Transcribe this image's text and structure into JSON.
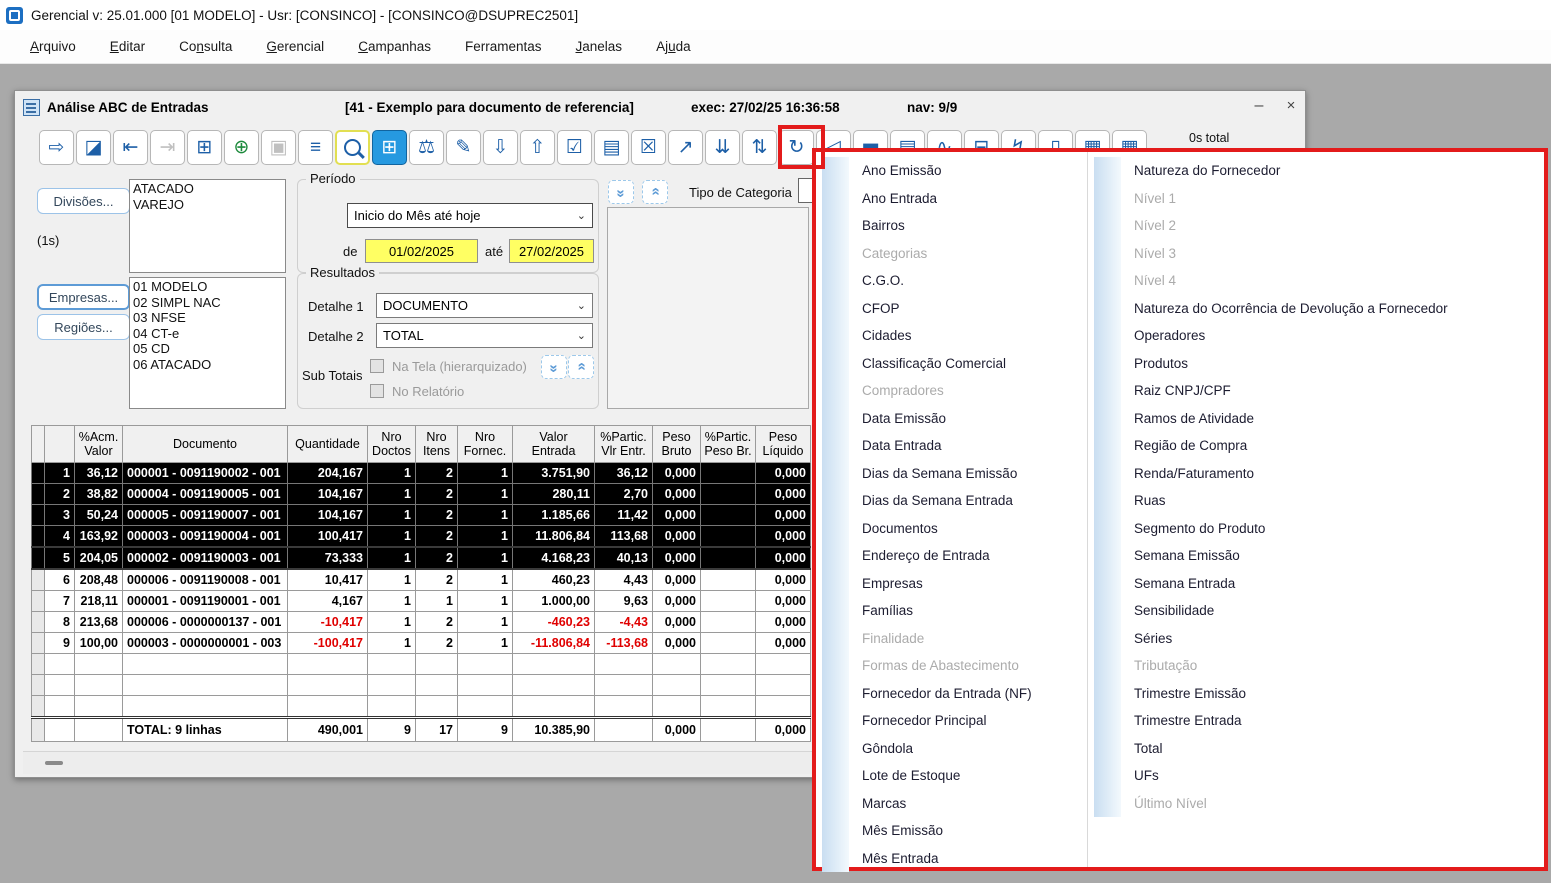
{
  "app": {
    "title": "Gerencial  v: 25.01.000   [01 MODELO] - Usr: [CONSINCO] - [CONSINCO@DSUPREC2501]",
    "menubar": [
      {
        "pre": "",
        "key": "A",
        "post": "rquivo"
      },
      {
        "pre": "",
        "key": "E",
        "post": "ditar"
      },
      {
        "pre": "Co",
        "key": "n",
        "post": "sulta"
      },
      {
        "pre": "",
        "key": "G",
        "post": "erencial"
      },
      {
        "pre": "",
        "key": "C",
        "post": "ampanhas"
      },
      {
        "pre": "Ferramentas",
        "key": "",
        "post": ""
      },
      {
        "pre": "",
        "key": "J",
        "post": "anelas"
      },
      {
        "pre": "Aj",
        "key": "u",
        "post": "da"
      }
    ]
  },
  "window": {
    "title": "Análise ABC de Entradas",
    "subtitle": "[41 - Exemplo para documento de referencia]",
    "exec_label": "exec: 27/02/25 16:36:58",
    "nav_label": "nav: 9/9",
    "minimize_glyph": "–",
    "close_glyph": "×"
  },
  "toolbar": {
    "timer_label": "0s total",
    "buttons": [
      {
        "name": "exit-button",
        "glyph": "⇨",
        "state": ""
      },
      {
        "name": "clear-eraser-button",
        "glyph": "◪",
        "state": ""
      },
      {
        "name": "first-record-button",
        "glyph": "⇤",
        "state": ""
      },
      {
        "name": "last-record-button",
        "glyph": "⇥",
        "state": "disabled"
      },
      {
        "name": "grid-view-button",
        "glyph": "⊞",
        "state": ""
      },
      {
        "name": "add-button",
        "glyph": "⊕",
        "state": "green"
      },
      {
        "name": "save-button",
        "glyph": "▣",
        "state": "disabled"
      },
      {
        "name": "filter-button",
        "glyph": "≡",
        "state": ""
      },
      {
        "name": "search-button",
        "glyph": "",
        "state": "search"
      },
      {
        "name": "calc-grid-button",
        "glyph": "⊞",
        "state": "active"
      },
      {
        "name": "scales-button",
        "glyph": "⚖",
        "state": ""
      },
      {
        "name": "edit-pencil-button",
        "glyph": "✎",
        "state": ""
      },
      {
        "name": "sort-desc-button",
        "glyph": "⇩",
        "state": ""
      },
      {
        "name": "sort-asc-button",
        "glyph": "⇧",
        "state": ""
      },
      {
        "name": "check-list-button",
        "glyph": "☑",
        "state": ""
      },
      {
        "name": "option-list-button",
        "glyph": "▤",
        "state": ""
      },
      {
        "name": "uncheck-list-button",
        "glyph": "☒",
        "state": ""
      },
      {
        "name": "external-link-button",
        "glyph": "↗",
        "state": ""
      },
      {
        "name": "collapse-groups-button",
        "glyph": "⇊",
        "state": ""
      },
      {
        "name": "expand-groups-button",
        "glyph": "⇅",
        "state": ""
      },
      {
        "name": "add-dimension-button",
        "glyph": "↻",
        "state": ""
      },
      {
        "name": "announce-button",
        "glyph": "◁",
        "state": ""
      },
      {
        "name": "bar-chart-button",
        "glyph": "▅",
        "state": ""
      },
      {
        "name": "hbar-chart-button",
        "glyph": "▤",
        "state": ""
      },
      {
        "name": "line-chart-button",
        "glyph": "∿",
        "state": ""
      },
      {
        "name": "print-button",
        "glyph": "⊟",
        "state": ""
      },
      {
        "name": "export-flash-button",
        "glyph": "↯",
        "state": ""
      },
      {
        "name": "document-button",
        "glyph": "▯",
        "state": ""
      },
      {
        "name": "report-grid-button-1",
        "glyph": "▦",
        "state": ""
      },
      {
        "name": "report-grid-button-2",
        "glyph": "▦",
        "state": ""
      }
    ]
  },
  "filters": {
    "divisoes_button": "Divisões...",
    "divisoes_items": [
      "ATACADO",
      "VAREJO"
    ],
    "elapsed_label": "(1s)",
    "empresas_button": "Empresas...",
    "regioes_button": "Regiões...",
    "empresas_items": [
      "01 MODELO",
      "02 SIMPL NAC",
      "03 NFSE",
      "04 CT-e",
      "05 CD",
      "06 ATACADO"
    ]
  },
  "periodo": {
    "group_label": "Período",
    "preset_value": "Inicio do Mês até hoje",
    "de_label": "de",
    "de_value": "01/02/2025",
    "ate_label": "até",
    "ate_value": "27/02/2025"
  },
  "resultados": {
    "group_label": "Resultados",
    "detalhe1_label": "Detalhe 1",
    "detalhe1_value": "DOCUMENTO",
    "detalhe2_label": "Detalhe 2",
    "detalhe2_value": "TOTAL",
    "subtotais_label": "Sub Totais",
    "chk_tela_label": "Na Tela (hierarquizado)",
    "chk_relatorio_label": "No Relatório"
  },
  "categoria": {
    "tipo_label": "Tipo de Categoria"
  },
  "icons": {
    "chevron_double": "»",
    "select_caret": "⌄"
  },
  "table": {
    "columns": [
      "%Acm.\nValor",
      "Documento",
      "Quantidade",
      "Nro\nDoctos",
      "Nro\nItens",
      "Nro\nFornec.",
      "Valor\nEntrada",
      "%Partic.\nVlr Entr.",
      "Peso\nBruto",
      "%Partic.\nPeso Br.",
      "Peso\nLíquido"
    ],
    "rows": [
      {
        "n": "1",
        "selected": true,
        "focus": false,
        "cells": [
          "36,12",
          "000001 - 0091190002 - 001",
          "204,167",
          "1",
          "2",
          "1",
          "3.751,90",
          "36,12",
          "0,000",
          "",
          "0,000"
        ]
      },
      {
        "n": "2",
        "selected": true,
        "focus": false,
        "cells": [
          "38,82",
          "000004 - 0091190005 - 001",
          "104,167",
          "1",
          "2",
          "1",
          "280,11",
          "2,70",
          "0,000",
          "",
          "0,000"
        ]
      },
      {
        "n": "3",
        "selected": true,
        "focus": false,
        "cells": [
          "50,24",
          "000005 - 0091190007 - 001",
          "104,167",
          "1",
          "2",
          "1",
          "1.185,66",
          "11,42",
          "0,000",
          "",
          "0,000"
        ]
      },
      {
        "n": "4",
        "selected": true,
        "focus": false,
        "cells": [
          "163,92",
          "000003 - 0091190004 - 001",
          "100,417",
          "1",
          "2",
          "1",
          "11.806,84",
          "113,68",
          "0,000",
          "",
          "0,000"
        ]
      },
      {
        "n": "5",
        "selected": true,
        "focus": true,
        "cells": [
          "204,05",
          "000002 - 0091190003 - 001",
          "73,333",
          "1",
          "2",
          "1",
          "4.168,23",
          "40,13",
          "0,000",
          "",
          "0,000"
        ]
      },
      {
        "n": "6",
        "selected": false,
        "focus": false,
        "cells": [
          "208,48",
          "000006 - 0091190008 - 001",
          "10,417",
          "1",
          "2",
          "1",
          "460,23",
          "4,43",
          "0,000",
          "",
          "0,000"
        ]
      },
      {
        "n": "7",
        "selected": false,
        "focus": false,
        "cells": [
          "218,11",
          "000001 - 0091190001 - 001",
          "4,167",
          "1",
          "1",
          "1",
          "1.000,00",
          "9,63",
          "0,000",
          "",
          "0,000"
        ]
      },
      {
        "n": "8",
        "selected": false,
        "focus": false,
        "cells": [
          "213,68",
          "000006 - 0000000137 - 001",
          "-10,417",
          "1",
          "2",
          "1",
          "-460,23",
          "-4,43",
          "0,000",
          "",
          "0,000"
        ]
      },
      {
        "n": "9",
        "selected": false,
        "focus": false,
        "cells": [
          "100,00",
          "000003 - 0000000001 - 003",
          "-100,417",
          "1",
          "2",
          "1",
          "-11.806,84",
          "-113,68",
          "0,000",
          "",
          "0,000"
        ]
      }
    ],
    "empty_row_count": 3,
    "total_row": {
      "cells": [
        "",
        "TOTAL: 9 linhas",
        "490,001",
        "9",
        "17",
        "9",
        "10.385,90",
        "",
        "0,000",
        "",
        "0,000"
      ]
    }
  },
  "popup": {
    "left_items": [
      {
        "label": "Ano Emissão",
        "disabled": false
      },
      {
        "label": "Ano Entrada",
        "disabled": false
      },
      {
        "label": "Bairros",
        "disabled": false
      },
      {
        "label": "Categorias",
        "disabled": true
      },
      {
        "label": "C.G.O.",
        "disabled": false
      },
      {
        "label": "CFOP",
        "disabled": false
      },
      {
        "label": "Cidades",
        "disabled": false
      },
      {
        "label": "Classificação Comercial",
        "disabled": false
      },
      {
        "label": "Compradores",
        "disabled": true
      },
      {
        "label": "Data Emissão",
        "disabled": false
      },
      {
        "label": "Data Entrada",
        "disabled": false
      },
      {
        "label": "Dias da Semana Emissão",
        "disabled": false
      },
      {
        "label": "Dias da Semana Entrada",
        "disabled": false
      },
      {
        "label": "Documentos",
        "disabled": false
      },
      {
        "label": "Endereço de Entrada",
        "disabled": false
      },
      {
        "label": "Empresas",
        "disabled": false
      },
      {
        "label": "Famílias",
        "disabled": false
      },
      {
        "label": "Finalidade",
        "disabled": true
      },
      {
        "label": "Formas de Abastecimento",
        "disabled": true
      },
      {
        "label": "Fornecedor da Entrada (NF)",
        "disabled": false
      },
      {
        "label": "Fornecedor Principal",
        "disabled": false
      },
      {
        "label": "Gôndola",
        "disabled": false
      },
      {
        "label": "Lote de Estoque",
        "disabled": false
      },
      {
        "label": "Marcas",
        "disabled": false
      },
      {
        "label": "Mês Emissão",
        "disabled": false
      },
      {
        "label": "Mês Entrada",
        "disabled": false
      }
    ],
    "right_items": [
      {
        "label": "Natureza do Fornecedor",
        "disabled": false
      },
      {
        "label": "Nível 1",
        "disabled": true
      },
      {
        "label": "Nível 2",
        "disabled": true
      },
      {
        "label": "Nível 3",
        "disabled": true
      },
      {
        "label": "Nível 4",
        "disabled": true
      },
      {
        "label": "Natureza do Ocorrência de Devolução a Fornecedor",
        "disabled": false
      },
      {
        "label": "Operadores",
        "disabled": false
      },
      {
        "label": "Produtos",
        "disabled": false
      },
      {
        "label": "Raiz CNPJ/CPF",
        "disabled": false
      },
      {
        "label": "Ramos de Atividade",
        "disabled": false
      },
      {
        "label": "Região de Compra",
        "disabled": false
      },
      {
        "label": "Renda/Faturamento",
        "disabled": false
      },
      {
        "label": "Ruas",
        "disabled": false
      },
      {
        "label": "Segmento do Produto",
        "disabled": false
      },
      {
        "label": "Semana Emissão",
        "disabled": false
      },
      {
        "label": "Semana Entrada",
        "disabled": false
      },
      {
        "label": "Sensibilidade",
        "disabled": false
      },
      {
        "label": "Séries",
        "disabled": false
      },
      {
        "label": "Tributação",
        "disabled": true
      },
      {
        "label": "Trimestre Emissão",
        "disabled": false
      },
      {
        "label": "Trimestre Entrada",
        "disabled": false
      },
      {
        "label": "Total",
        "disabled": false
      },
      {
        "label": "UFs",
        "disabled": false
      },
      {
        "label": "Último Nível",
        "disabled": true
      }
    ]
  }
}
